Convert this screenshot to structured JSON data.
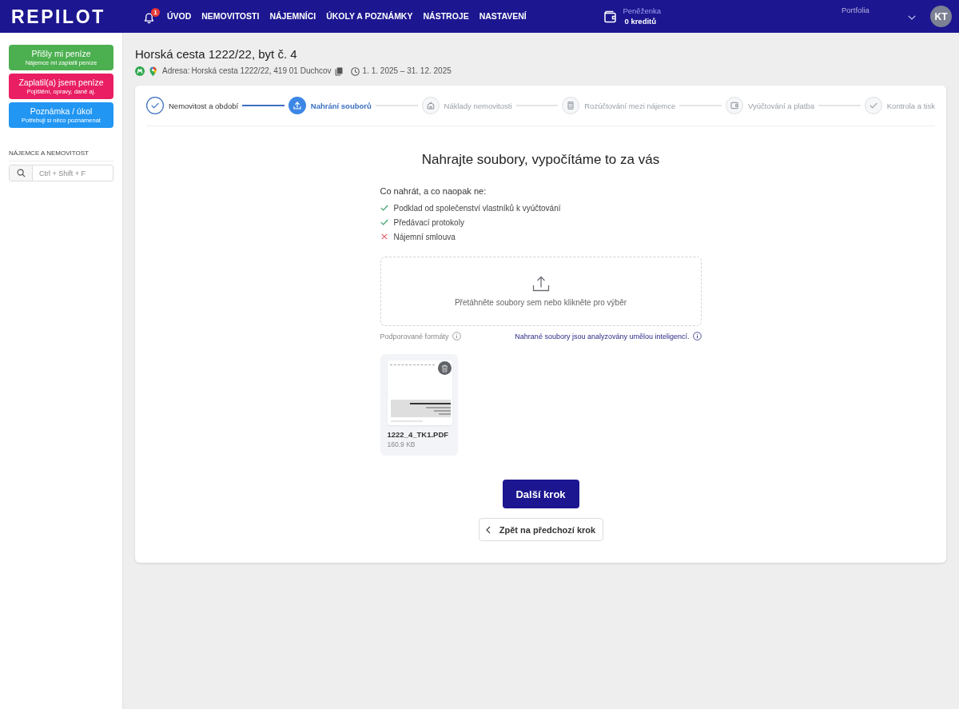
{
  "topbar": {
    "logo": "REPILOT",
    "notifications": {
      "badge": "1"
    },
    "nav": [
      {
        "label": "ÚVOD",
        "selected": false
      },
      {
        "label": "NEMOVITOSTI",
        "selected": false
      },
      {
        "label": "NÁJEMNÍCI",
        "selected": false
      },
      {
        "label": "ÚKOLY A POZNÁMKY",
        "selected": false
      },
      {
        "label": "NÁSTROJE",
        "selected": false
      },
      {
        "label": "NASTAVENÍ",
        "selected": false
      }
    ],
    "wallet": {
      "label": "Peněženka",
      "value": "0 kreditů"
    },
    "portfolio": {
      "label": "Portfolia"
    },
    "avatar": {
      "initials": "KT"
    }
  },
  "sidebar": {
    "actions": [
      {
        "title": "Přišly mi peníze",
        "subtitle": "Nájemce mi zaplatil peníze",
        "color": "#4caf50"
      },
      {
        "title": "Zaplatil(a) jsem peníze",
        "subtitle": "Pojištění, opravy, daně aj.",
        "color": "#e91e63"
      },
      {
        "title": "Poznámka / úkol",
        "subtitle": "Potřebuji si něco poznamenat",
        "color": "#2196f3"
      }
    ],
    "search": {
      "label": "NÁJEMCE A NEMOVITOST",
      "placeholder": "Ctrl + Shift + F"
    }
  },
  "property": {
    "title": "Horská cesta 1222/22, byt č. 4",
    "address_label": "Adresa:",
    "address": "Horská cesta 1222/22, 419 01 Duchcov",
    "period": "1. 1. 2025 – 31. 12. 2025"
  },
  "stepper": [
    {
      "label": "Nemovitost a období",
      "completed": true,
      "selected": false
    },
    {
      "label": "Nahrání souborů",
      "completed": false,
      "selected": true
    },
    {
      "label": "Náklady nemovitosti",
      "completed": false,
      "selected": false
    },
    {
      "label": "Rozúčtování mezi nájemce",
      "completed": false,
      "selected": false
    },
    {
      "label": "Vyúčtování a platba",
      "completed": false,
      "selected": false
    },
    {
      "label": "Kontrola a tisk",
      "completed": false,
      "selected": false
    }
  ],
  "upload": {
    "heading": "Nahrajte soubory, vypočítáme to za vás",
    "guide_title": "Co nahrát, a co naopak ne:",
    "guide": [
      {
        "text": "Podklad od společenství vlastníků k vyúčtování",
        "allowed": true
      },
      {
        "text": "Předávací protokoly",
        "allowed": true
      },
      {
        "text": "Nájemní smlouva",
        "allowed": false
      }
    ],
    "dropzone_text": "Přetáhněte soubory sem nebo klikněte pro výběr",
    "formats_label": "Podporované formáty",
    "ai_note": "Nahrané soubory jsou analyzovány umělou inteligencí.",
    "files": [
      {
        "name": "1222_4_TK1.PDF",
        "size": "160.9 KB"
      }
    ]
  },
  "actions": {
    "next": "Další krok",
    "back": "Zpět na předchozí krok"
  }
}
